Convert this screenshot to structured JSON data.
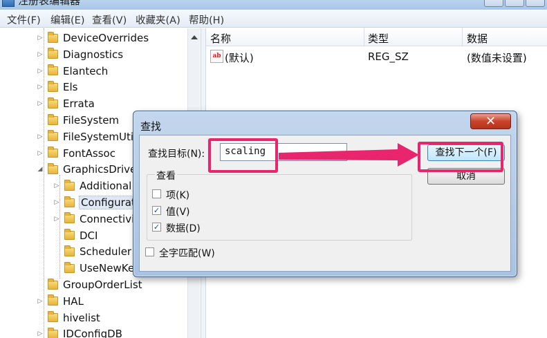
{
  "window": {
    "title": "注册表编辑器"
  },
  "menu": [
    {
      "label": "文件(F)"
    },
    {
      "label": "编辑(E)"
    },
    {
      "label": "查看(V)"
    },
    {
      "label": "收藏夹(A)"
    },
    {
      "label": "帮助(H)"
    }
  ],
  "tree": [
    {
      "label": "DeviceOverrides",
      "depth": 0,
      "expander": "▷"
    },
    {
      "label": "Diagnostics",
      "depth": 0,
      "expander": "▷"
    },
    {
      "label": "Elantech",
      "depth": 0,
      "expander": "▷"
    },
    {
      "label": "Els",
      "depth": 0,
      "expander": "▷"
    },
    {
      "label": "Errata",
      "depth": 0,
      "expander": "▷"
    },
    {
      "label": "FileSystem",
      "depth": 0,
      "expander": ""
    },
    {
      "label": "FileSystemUti",
      "depth": 0,
      "expander": "▷"
    },
    {
      "label": "FontAssoc",
      "depth": 0,
      "expander": "▷"
    },
    {
      "label": "GraphicsDrive",
      "depth": 0,
      "expander": "◢"
    },
    {
      "label": "Additional",
      "depth": 1,
      "expander": "▷"
    },
    {
      "label": "Configurat",
      "depth": 1,
      "expander": "▷",
      "selected": true
    },
    {
      "label": "Connectivi",
      "depth": 1,
      "expander": "▷"
    },
    {
      "label": "DCI",
      "depth": 1,
      "expander": ""
    },
    {
      "label": "Scheduler",
      "depth": 1,
      "expander": ""
    },
    {
      "label": "UseNewKe",
      "depth": 1,
      "expander": ""
    },
    {
      "label": "GroupOrderList",
      "depth": 0,
      "expander": ""
    },
    {
      "label": "HAL",
      "depth": 0,
      "expander": "▷"
    },
    {
      "label": "hivelist",
      "depth": 0,
      "expander": ""
    },
    {
      "label": "IDConfigDB",
      "depth": 0,
      "expander": "▷"
    }
  ],
  "list": {
    "columns": [
      {
        "label": "名称"
      },
      {
        "label": "类型"
      },
      {
        "label": "数据"
      }
    ],
    "rows": [
      {
        "icon": "ab",
        "name": "(默认)",
        "type": "REG_SZ",
        "data": "(数值未设置)"
      }
    ]
  },
  "find_dialog": {
    "title": "查找",
    "close_label": "✕",
    "target_label": "查找目标(N):",
    "target_value": "scaling",
    "find_next_label": "查找下一个(F)",
    "cancel_label": "取消",
    "look_group_label": "查看",
    "options": [
      {
        "label": "项(K)",
        "checked": false
      },
      {
        "label": "值(V)",
        "checked": true
      },
      {
        "label": "数据(D)",
        "checked": true
      }
    ],
    "whole_match": {
      "label": "全字匹配(W)",
      "checked": false
    }
  },
  "colors": {
    "annotation": "#e8266e"
  }
}
